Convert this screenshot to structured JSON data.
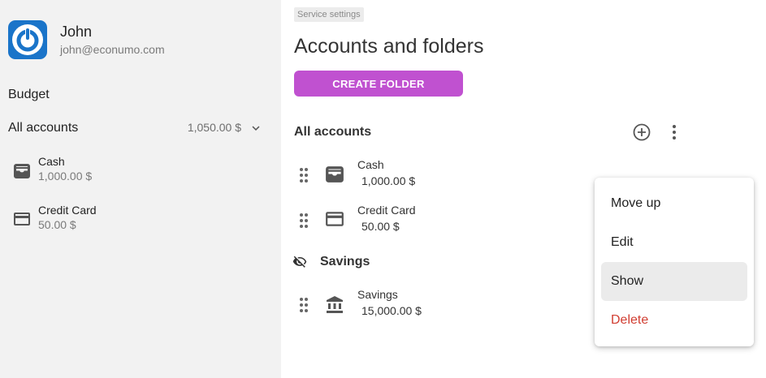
{
  "user": {
    "name": "John",
    "email": "john@econumo.com"
  },
  "sidebar": {
    "budget_label": "Budget",
    "all_accounts": {
      "label": "All accounts",
      "total": "1,050.00 $"
    },
    "accounts": [
      {
        "name": "Cash",
        "amount": "1,000.00 $",
        "icon": "wallet-icon"
      },
      {
        "name": "Credit Card",
        "amount": "50.00 $",
        "icon": "credit-card-icon"
      }
    ]
  },
  "main": {
    "breadcrumb": "Service settings",
    "title": "Accounts and folders",
    "create_folder_label": "CREATE FOLDER",
    "folders": [
      {
        "name": "All accounts",
        "hidden": false,
        "accounts": [
          {
            "name": "Cash",
            "amount": "1,000.00 $",
            "icon": "wallet-icon"
          },
          {
            "name": "Credit Card",
            "amount": "50.00 $",
            "icon": "credit-card-icon"
          }
        ]
      },
      {
        "name": "Savings",
        "hidden": true,
        "accounts": [
          {
            "name": "Savings",
            "amount": "15,000.00 $",
            "icon": "bank-icon"
          }
        ]
      }
    ]
  },
  "context_menu": {
    "items": [
      {
        "label": "Move up"
      },
      {
        "label": "Edit"
      },
      {
        "label": "Show",
        "highlighted": true
      },
      {
        "label": "Delete",
        "destructive": true
      }
    ]
  },
  "colors": {
    "accent": "#c051d0",
    "avatar": "#1a74c9",
    "danger": "#d13e32",
    "sidebar_bg": "#f2f2f2"
  }
}
